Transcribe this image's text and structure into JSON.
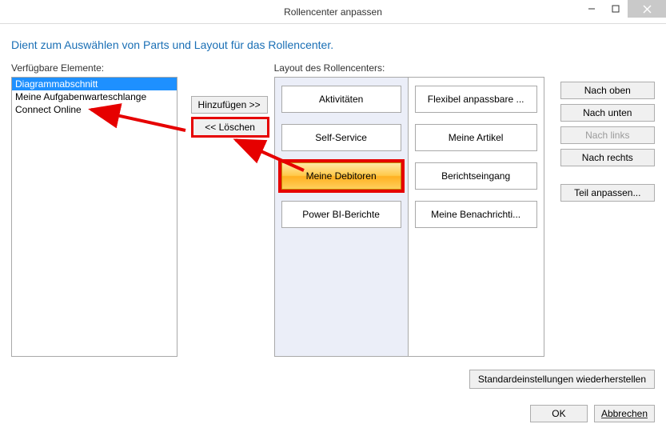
{
  "window": {
    "title": "Rollencenter anpassen"
  },
  "subtitle": "Dient zum Auswählen von Parts und Layout für das Rollencenter.",
  "available": {
    "label": "Verfügbare Elemente:",
    "items": [
      "Diagrammabschnitt",
      "Meine Aufgabenwarteschlange",
      "Connect Online"
    ]
  },
  "middle": {
    "add": "Hinzufügen >>",
    "remove": "<< Löschen"
  },
  "layout": {
    "label": "Layout des Rollencenters:",
    "left": [
      "Aktivitäten",
      "Self-Service",
      "Meine Debitoren",
      "Power BI-Berichte"
    ],
    "right": [
      "Flexibel anpassbare ...",
      "Meine Artikel",
      "Berichtseingang",
      "Meine Benachrichti..."
    ]
  },
  "rightbuttons": {
    "up": "Nach oben",
    "down": "Nach unten",
    "left": "Nach links",
    "right": "Nach rechts",
    "customize": "Teil anpassen..."
  },
  "bottom": {
    "restore": "Standardeinstellungen wiederherstellen",
    "ok": "OK",
    "cancel": "Abbrechen"
  }
}
